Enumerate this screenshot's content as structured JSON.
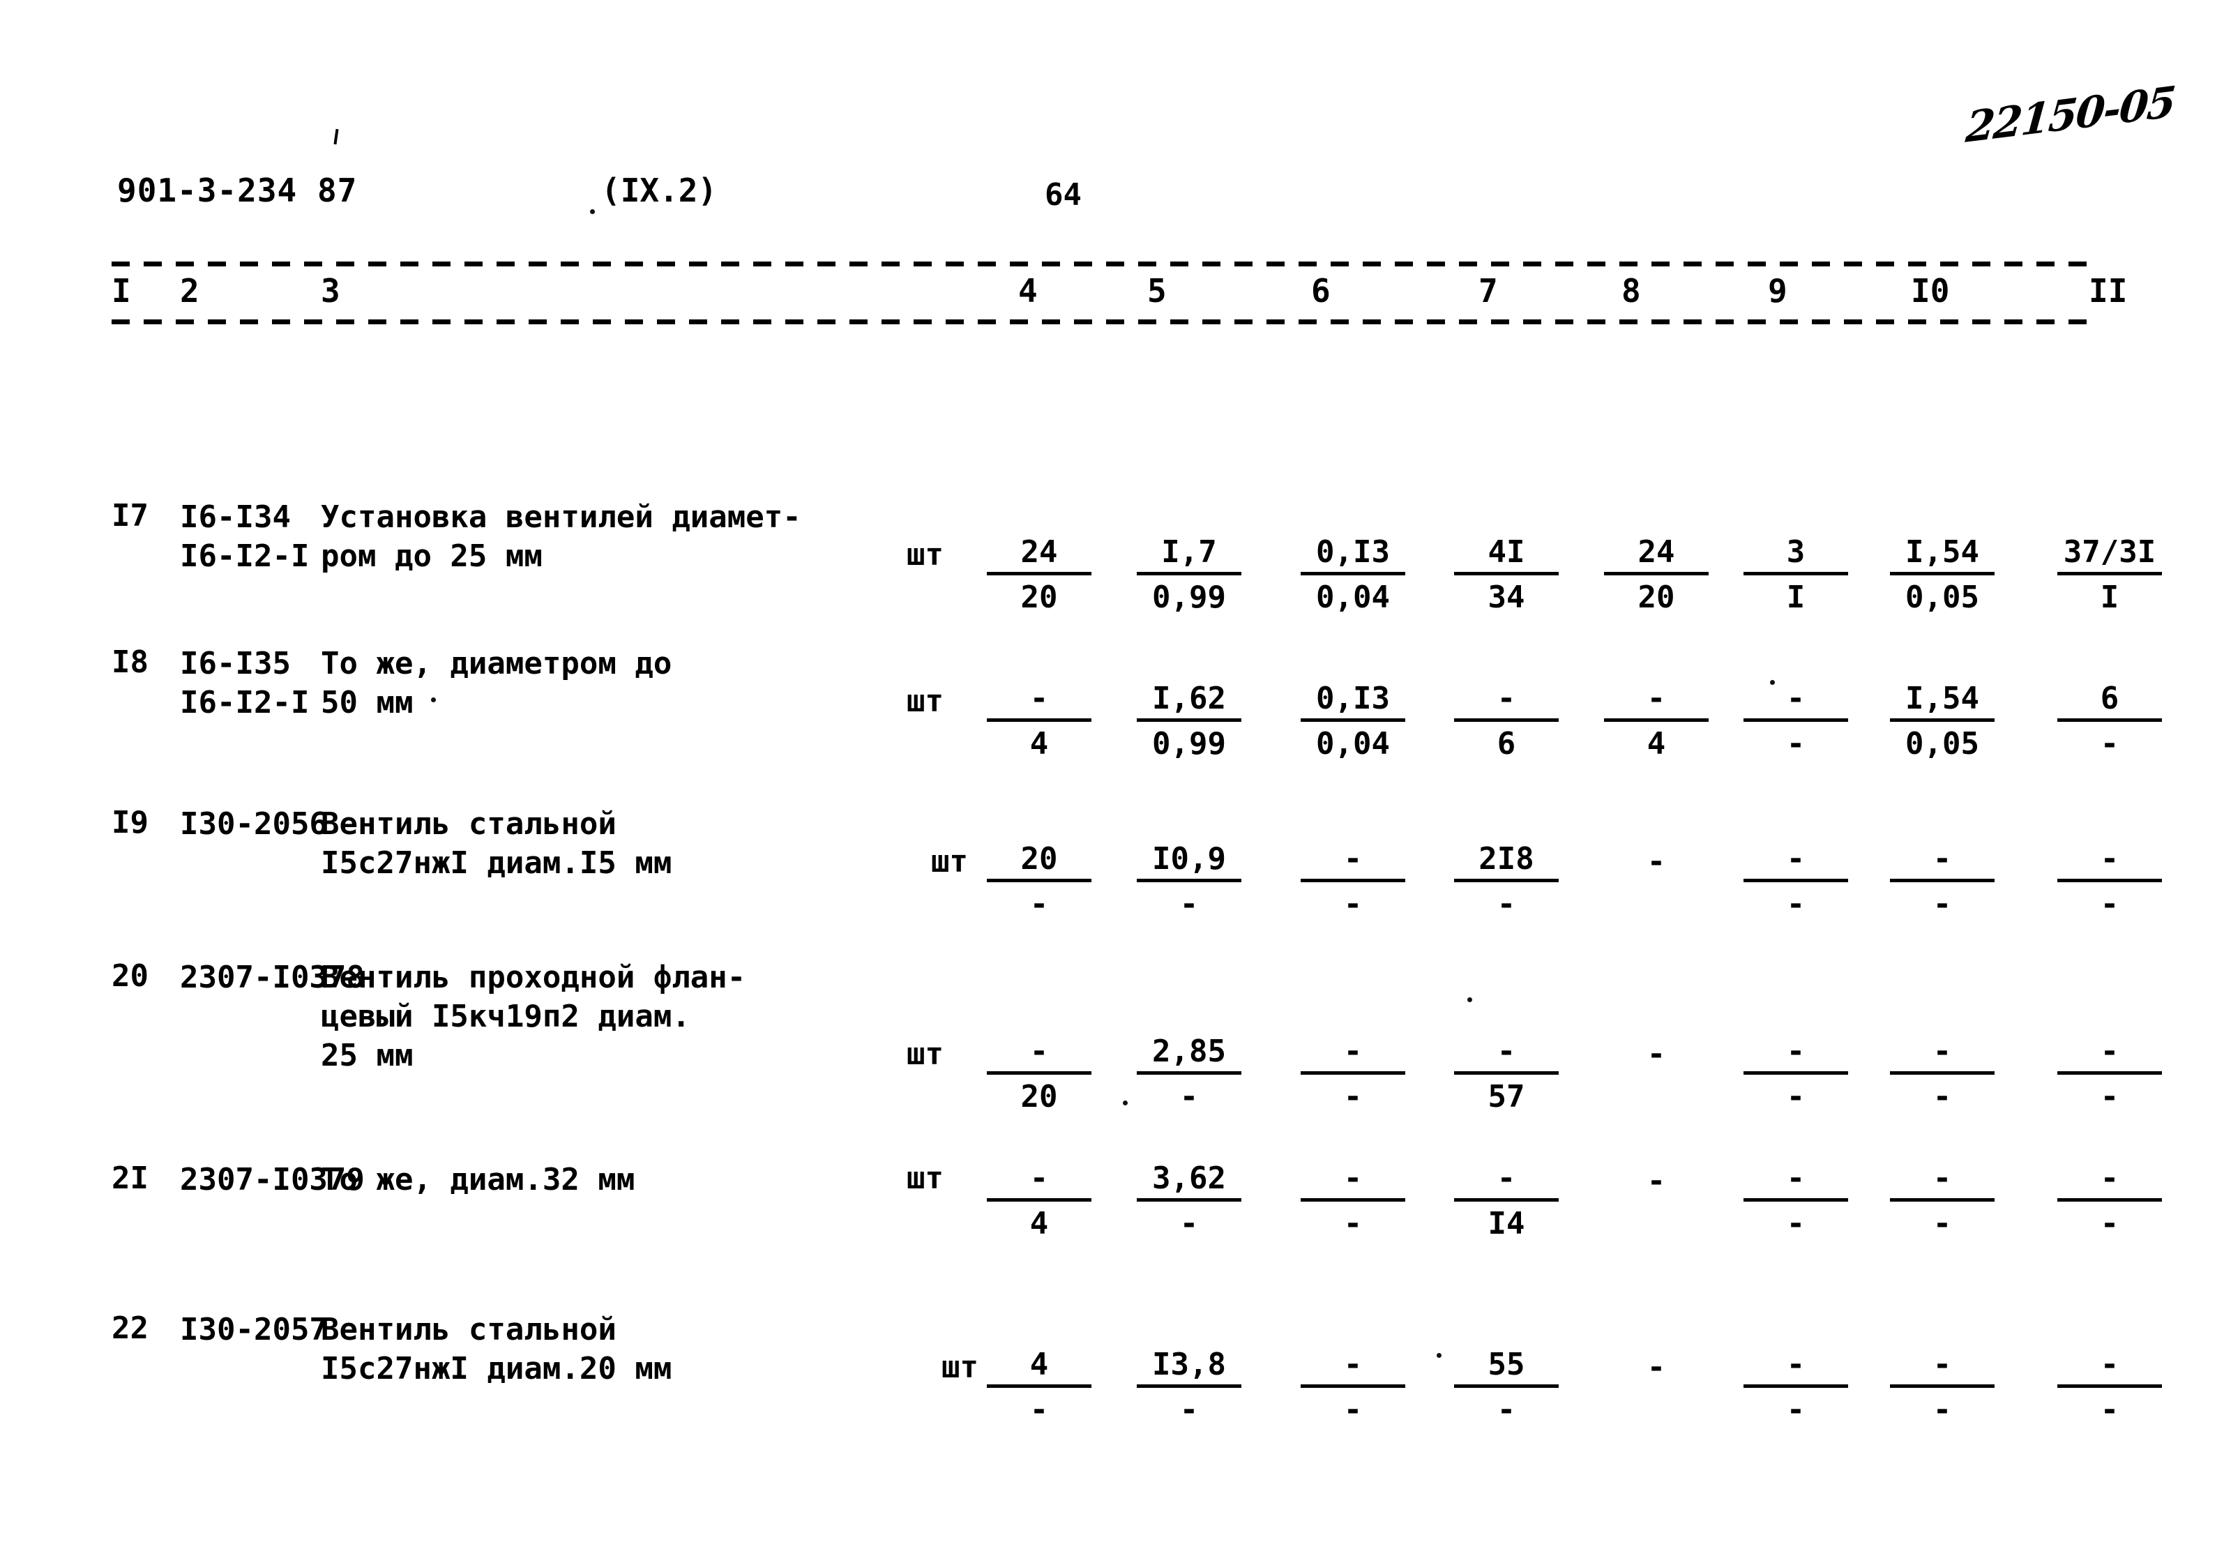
{
  "annotation": {
    "handwritten_note": "22150-05"
  },
  "header": {
    "document_code": "901-3-234 87",
    "section": "(IX.2)",
    "page_number": "64"
  },
  "table": {
    "column_headers": [
      "I",
      "2",
      "3",
      "4",
      "5",
      "6",
      "7",
      "8",
      "9",
      "I0",
      "II"
    ],
    "rows": [
      {
        "num": "I7",
        "code_line1": "I6-I34",
        "code_line2": "I6-I2-I",
        "name_line1": "Установка вентилей диамет-",
        "name_line2": "ром до 25 мм",
        "name_line3": "",
        "unit": "шт",
        "cells": [
          {
            "top": "24",
            "bot": "20"
          },
          {
            "top": "I,7",
            "bot": "0,99"
          },
          {
            "top": "0,I3",
            "bot": "0,04"
          },
          {
            "top": "4I",
            "bot": "34"
          },
          {
            "top": "24",
            "bot": "20"
          },
          {
            "top": "3",
            "bot": "I"
          },
          {
            "top": "I,54",
            "bot": "0,05"
          },
          {
            "top": "37/3I",
            "bot": "I"
          }
        ]
      },
      {
        "num": "I8",
        "code_line1": "I6-I35",
        "code_line2": "I6-I2-I",
        "name_line1": "То же, диаметром до",
        "name_line2": "50 мм",
        "name_line3": "",
        "unit": "шт",
        "cells": [
          {
            "top": "-",
            "bot": "4"
          },
          {
            "top": "I,62",
            "bot": "0,99"
          },
          {
            "top": "0,I3",
            "bot": "0,04"
          },
          {
            "top": "-",
            "bot": "6"
          },
          {
            "top": "-",
            "bot": "4"
          },
          {
            "top": "-",
            "bot": "-"
          },
          {
            "top": "I,54",
            "bot": "0,05"
          },
          {
            "top": "6",
            "bot": "-"
          }
        ]
      },
      {
        "num": "I9",
        "code_line1": "I30-2056",
        "code_line2": "",
        "name_line1": "Вентиль стальной",
        "name_line2": "I5с27нжI диам.I5 мм",
        "name_line3": "",
        "unit": "шт",
        "cells": [
          {
            "top": "20",
            "bot": "-"
          },
          {
            "top": "I0,9",
            "bot": "-"
          },
          {
            "top": "-",
            "bot": "-"
          },
          {
            "top": "2I8",
            "bot": "-"
          },
          {
            "top": "-",
            "bot": "",
            "single": true
          },
          {
            "top": "-",
            "bot": "-"
          },
          {
            "top": "-",
            "bot": "-"
          },
          {
            "top": "-",
            "bot": "-"
          }
        ]
      },
      {
        "num": "20",
        "code_line1": "2307-I0378",
        "code_line2": "",
        "name_line1": "Вентиль проходной флан-",
        "name_line2": "цевый I5кч19п2 диам.",
        "name_line3": "25 мм",
        "unit": "шт",
        "cells": [
          {
            "top": "-",
            "bot": "20"
          },
          {
            "top": "2,85",
            "bot": "-"
          },
          {
            "top": "-",
            "bot": "-"
          },
          {
            "top": "-",
            "bot": "57"
          },
          {
            "top": "-",
            "bot": "",
            "single": true
          },
          {
            "top": "-",
            "bot": "-"
          },
          {
            "top": "-",
            "bot": "-"
          },
          {
            "top": "-",
            "bot": "-"
          }
        ]
      },
      {
        "num": "2I",
        "code_line1": "2307-I0379",
        "code_line2": "",
        "name_line1": "То же, диам.32 мм",
        "name_line2": "",
        "name_line3": "",
        "unit": "шт",
        "cells": [
          {
            "top": "-",
            "bot": "4"
          },
          {
            "top": "3,62",
            "bot": "-"
          },
          {
            "top": "-",
            "bot": "-"
          },
          {
            "top": "-",
            "bot": "I4"
          },
          {
            "top": "-",
            "bot": "",
            "single": true
          },
          {
            "top": "-",
            "bot": "-"
          },
          {
            "top": "-",
            "bot": "-"
          },
          {
            "top": "-",
            "bot": "-"
          }
        ]
      },
      {
        "num": "22",
        "code_line1": "I30-2057",
        "code_line2": "",
        "name_line1": "Вентиль стальной",
        "name_line2": "I5с27нжI диам.20 мм",
        "name_line3": "",
        "unit": "шт",
        "cells": [
          {
            "top": "4",
            "bot": "-"
          },
          {
            "top": "I3,8",
            "bot": "-"
          },
          {
            "top": "-",
            "bot": "-"
          },
          {
            "top": "55",
            "bot": "-"
          },
          {
            "top": "-",
            "bot": "",
            "single": true
          },
          {
            "top": "-",
            "bot": "-"
          },
          {
            "top": "-",
            "bot": "-"
          },
          {
            "top": "-",
            "bot": "-"
          }
        ]
      }
    ]
  }
}
